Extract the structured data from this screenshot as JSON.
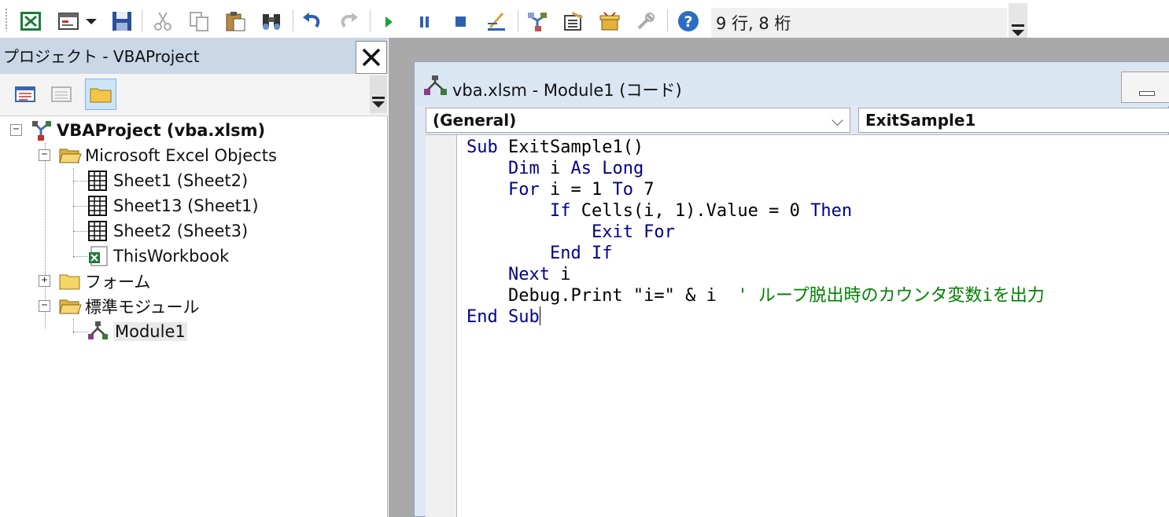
{
  "toolbar": {
    "position_text": "9 行, 8 桁"
  },
  "project_pane": {
    "title": "プロジェクト - VBAProject",
    "tree": {
      "root": "VBAProject (vba.xlsm)",
      "folder_objects": "Microsoft Excel Objects",
      "sheet1": "Sheet1 (Sheet2)",
      "sheet13": "Sheet13 (Sheet1)",
      "sheet2": "Sheet2 (Sheet3)",
      "workbook": "ThisWorkbook",
      "folder_forms": "フォーム",
      "folder_modules": "標準モジュール",
      "module1": "Module1"
    }
  },
  "code_window": {
    "title": "vba.xlsm - Module1 (コード)",
    "object_dropdown": "(General)",
    "procedure_dropdown": "ExitSample1",
    "lines": [
      [
        {
          "t": "Sub",
          "k": "kw"
        },
        {
          "t": " ExitSample1()"
        }
      ],
      [
        {
          "t": "    "
        },
        {
          "t": "Dim",
          "k": "kw"
        },
        {
          "t": " i "
        },
        {
          "t": "As Long",
          "k": "kw"
        }
      ],
      [
        {
          "t": "    "
        },
        {
          "t": "For",
          "k": "kw"
        },
        {
          "t": " i = 1 "
        },
        {
          "t": "To",
          "k": "kw"
        },
        {
          "t": " 7"
        }
      ],
      [
        {
          "t": "        "
        },
        {
          "t": "If",
          "k": "kw"
        },
        {
          "t": " Cells(i, 1).Value = 0 "
        },
        {
          "t": "Then",
          "k": "kw"
        }
      ],
      [
        {
          "t": "            "
        },
        {
          "t": "Exit For",
          "k": "kw"
        }
      ],
      [
        {
          "t": "        "
        },
        {
          "t": "End If",
          "k": "kw"
        }
      ],
      [
        {
          "t": "    "
        },
        {
          "t": "Next",
          "k": "kw"
        },
        {
          "t": " i"
        }
      ],
      [
        {
          "t": "    Debug.Print \"i=\" & i  "
        },
        {
          "t": "' ループ脱出時のカウンタ変数iを出力",
          "k": "cm"
        }
      ],
      [
        {
          "t": "End Sub",
          "k": "kw"
        }
      ]
    ]
  },
  "colors": {
    "keyword": "#00008b",
    "comment": "#008000",
    "pane_title_bg": "#c9d7e7",
    "mdi_bg": "#a9a9a9"
  }
}
